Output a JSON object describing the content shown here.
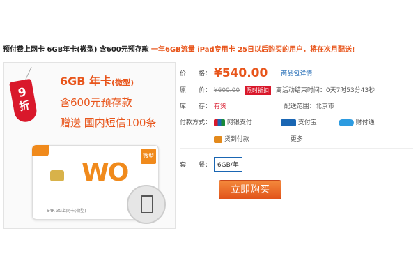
{
  "title": {
    "main": "预付费上网卡 6GB年卡(微型) 含600元预存款",
    "promo": "一年6GB流量 iPad专用卡 25日以后购买的用户，将在次月配送!"
  },
  "image": {
    "discount_number": "9",
    "discount_text": "折",
    "line1": "6GB 年卡",
    "line1_suffix": "(微型)",
    "line2": "含600元预存款",
    "line3": "赠送 国内短信100条",
    "sim_logo": "WO",
    "sim_badge": "微型",
    "sim_text": "64K 3G上网卡(微型)"
  },
  "price_row": {
    "label": "价　　格：",
    "value": "¥540.00",
    "link": "商品包详情"
  },
  "original_row": {
    "label": "原　　价：",
    "value": "¥600.00",
    "badge": "限时折扣",
    "countdown": "离活动结束时间：0天7时53分43秒"
  },
  "stock_row": {
    "label": "库　　存：",
    "value": "有货",
    "delivery": "配送范围：北京市"
  },
  "payment_row": {
    "label": "付款方式：",
    "methods": [
      "网银支付",
      "支付宝",
      "财付通",
      "货到付款"
    ],
    "more": "更多"
  },
  "package_row": {
    "label": "套　　餐：",
    "value": "6GB/年"
  },
  "buy_button": "立即购买",
  "colors": {
    "accent": "#e8551b",
    "red": "#d9182b",
    "link": "#1a66b3"
  }
}
